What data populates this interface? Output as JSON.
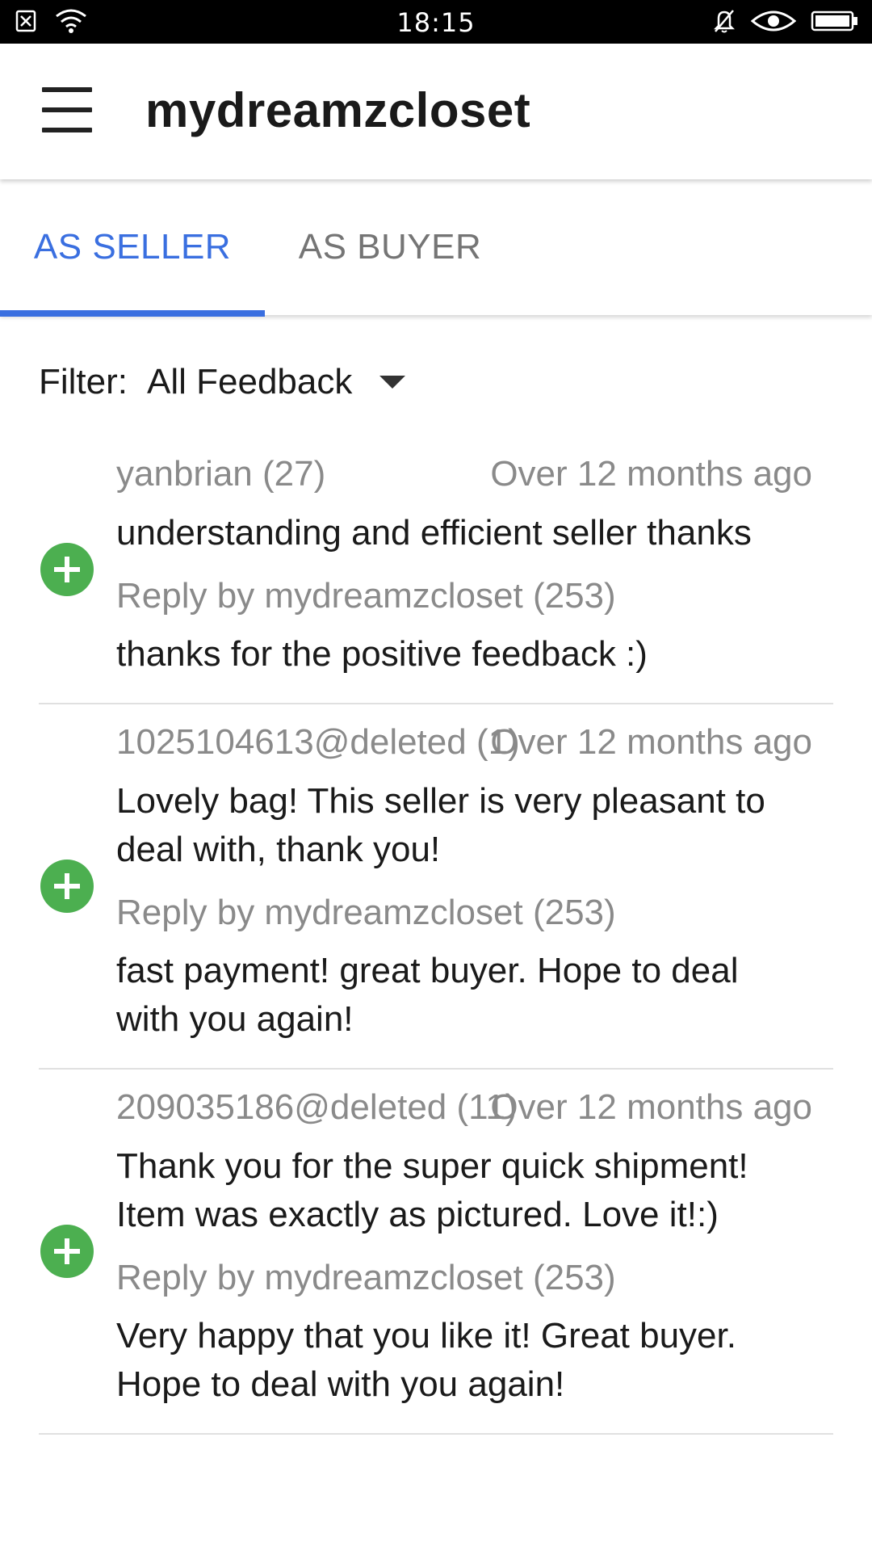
{
  "status_bar": {
    "time": "18:15",
    "icons": [
      "sim-off-icon",
      "wifi-icon",
      "bell-off-icon",
      "eye-icon",
      "battery-icon"
    ]
  },
  "app_bar": {
    "title": "mydreamzcloset",
    "menu_icon": "hamburger-menu-icon"
  },
  "tabs": [
    {
      "label": "AS SELLER",
      "active": true
    },
    {
      "label": "AS BUYER",
      "active": false
    }
  ],
  "colors": {
    "accent": "#3a6fe0",
    "positive": "#4caf50",
    "secondary_text": "#8a8a8a"
  },
  "filter": {
    "label": "Filter:",
    "value": "All Feedback"
  },
  "feedback": [
    {
      "user": "yanbrian (27)",
      "date": "Over 12 months ago",
      "comment": "understanding and efficient seller thanks",
      "reply_by": "Reply by mydreamzcloset (253)",
      "reply": "thanks for the positive feedback :)",
      "rating_icon": "positive-plus-icon"
    },
    {
      "user": "1025104613@deleted (1)",
      "date": "Over 12 months ago",
      "comment": "Lovely bag! This seller is very pleasant to deal with, thank you!",
      "reply_by": "Reply by mydreamzcloset (253)",
      "reply": "fast payment! great buyer. Hope to deal with you again!",
      "rating_icon": "positive-plus-icon"
    },
    {
      "user": "209035186@deleted (11)",
      "date": "Over 12 months ago",
      "comment": "Thank you for the super quick shipment! Item was exactly as pictured. Love it!:)",
      "reply_by": "Reply by mydreamzcloset (253)",
      "reply": "Very happy that you like it! Great buyer. Hope to deal with you again!",
      "rating_icon": "positive-plus-icon"
    }
  ]
}
